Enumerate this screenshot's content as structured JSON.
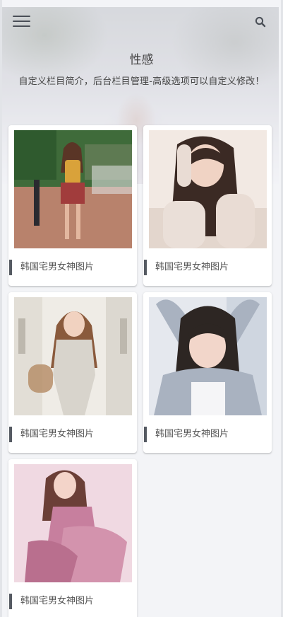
{
  "header": {
    "menu_icon": "hamburger-menu-icon",
    "search_icon": "search-icon",
    "title": "性感",
    "description": "自定义栏目简介，后台栏目管理-高级选项可以自定义修改！"
  },
  "gallery": {
    "items": [
      {
        "label": "韩国宅男女神图片",
        "thumb_colors": [
          "#b05a4e",
          "#d9a23a",
          "#3f6b3a"
        ]
      },
      {
        "label": "韩国宅男女神图片",
        "thumb_colors": [
          "#e9dcd4",
          "#3b2a24",
          "#f2e9e3"
        ]
      },
      {
        "label": "韩国宅男女神图片",
        "thumb_colors": [
          "#efece6",
          "#8a5a3c",
          "#d8d4cc"
        ]
      },
      {
        "label": "韩国宅男女神图片",
        "thumb_colors": [
          "#a9b2c0",
          "#2d2623",
          "#e5e8ee"
        ]
      },
      {
        "label": "韩国宅男女神图片",
        "thumb_colors": [
          "#f0d9e2",
          "#c77f9e",
          "#6b3f37"
        ]
      }
    ]
  },
  "colors": {
    "label_bar": "#555a62",
    "background": "#f3f4f7"
  }
}
